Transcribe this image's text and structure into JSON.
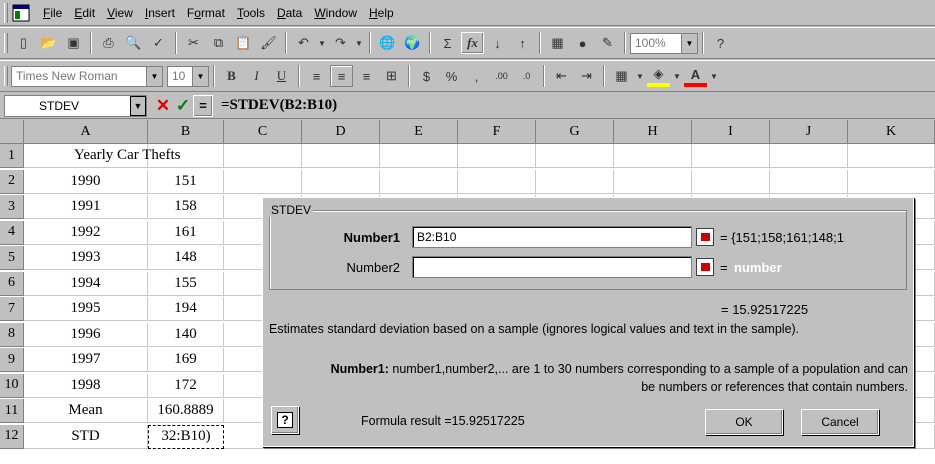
{
  "menu": [
    "File",
    "Edit",
    "View",
    "Insert",
    "Format",
    "Tools",
    "Data",
    "Window",
    "Help"
  ],
  "menu_underline": [
    "F",
    "E",
    "V",
    "I",
    "o",
    "T",
    "D",
    "W",
    "H"
  ],
  "toolbar": {
    "zoom": "100%",
    "font_name": "Times New Roman",
    "font_size": "10"
  },
  "formula_bar": {
    "name_box": "STDEV",
    "formula": "=STDEV(B2:B10)",
    "cancel_symbol": "✕",
    "enter_symbol": "✓",
    "equals_symbol": "="
  },
  "columns": [
    "A",
    "B",
    "C",
    "D",
    "E",
    "F",
    "G",
    "H",
    "I",
    "J",
    "K"
  ],
  "rows": [
    {
      "n": "1",
      "a": "Yearly Car Thefts",
      "b": ""
    },
    {
      "n": "2",
      "a": "1990",
      "b": "151"
    },
    {
      "n": "3",
      "a": "1991",
      "b": "158"
    },
    {
      "n": "4",
      "a": "1992",
      "b": "161"
    },
    {
      "n": "5",
      "a": "1993",
      "b": "148"
    },
    {
      "n": "6",
      "a": "1994",
      "b": "155"
    },
    {
      "n": "7",
      "a": "1995",
      "b": "194"
    },
    {
      "n": "8",
      "a": "1996",
      "b": "140"
    },
    {
      "n": "9",
      "a": "1997",
      "b": "169"
    },
    {
      "n": "10",
      "a": "1998",
      "b": "172"
    },
    {
      "n": "11",
      "a": "Mean",
      "b": "160.8889"
    },
    {
      "n": "12",
      "a": "STD",
      "b": "32:B10)"
    }
  ],
  "dialog": {
    "group_title": "STDEV",
    "number1_label": "Number1",
    "number1_value": "B2:B10",
    "number1_result": "= {151;158;161;148;1",
    "number2_label": "Number2",
    "number2_value": "",
    "number2_result_eq": "=",
    "number2_result": "number",
    "value_result": "= 15.92517225",
    "description": "Estimates standard deviation based on a sample (ignores logical values and text in the sample).",
    "arg_help_label": "Number1:",
    "arg_help_text": "number1,number2,... are 1 to 30 numbers corresponding to a sample of a population and can be numbers or references that contain numbers.",
    "formula_result": "Formula result =15.92517225",
    "ok": "OK",
    "cancel": "Cancel",
    "help_glyph": "?"
  }
}
